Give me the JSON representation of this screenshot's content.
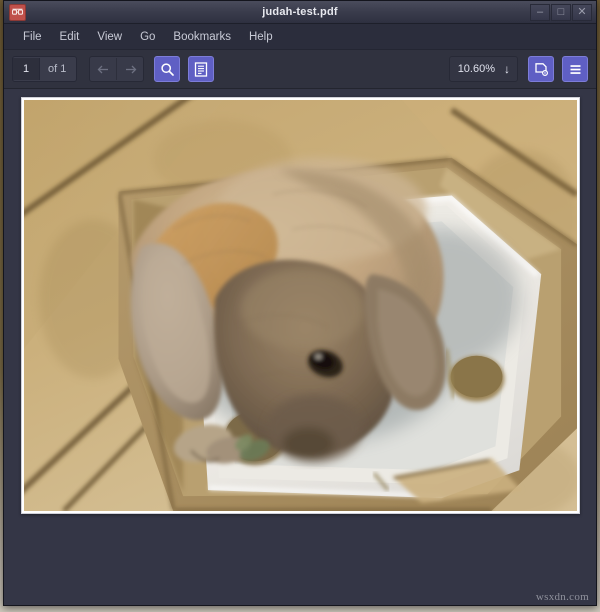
{
  "window": {
    "title": "judah-test.pdf",
    "app_icon": "document-viewer-icon",
    "controls": {
      "minimize": "–",
      "maximize": "□",
      "close": "✕"
    }
  },
  "menubar": {
    "items": [
      {
        "label": "File"
      },
      {
        "label": "Edit"
      },
      {
        "label": "View"
      },
      {
        "label": "Go"
      },
      {
        "label": "Bookmarks"
      },
      {
        "label": "Help"
      }
    ]
  },
  "toolbar": {
    "page_number": "1",
    "page_total": "of 1",
    "page_placeholder": "1",
    "previous_label": "←",
    "next_label": "→",
    "search_icon": "search-icon",
    "sidebar_icon": "document-outline-icon",
    "zoom_value": "10.60%",
    "zoom_arrow": "↓",
    "page_setup_icon": "page-settings-icon",
    "menu_icon": "hamburger-menu-icon"
  },
  "document": {
    "page_label": "1",
    "content_description": "Photograph of a lop-eared rabbit sitting on a white foam packing insert inside a cardboard box on beige tile flooring",
    "colors": {
      "tile": "#c8ac7c",
      "grout": "#6b5530",
      "foam": "#f0ece6",
      "cardboard": "#a98f60",
      "rabbit_light": "#cbb08a",
      "rabbit_mid": "#a88f72",
      "rabbit_dark": "#6b5b4c"
    }
  },
  "watermark": {
    "text": "wsxdn.com"
  },
  "theme": {
    "accent": "#5f5fc4",
    "titlebar": "#3b3d4d",
    "toolbar": "#30323f",
    "docview_bg": "#343646",
    "text": "#c8cad6"
  }
}
